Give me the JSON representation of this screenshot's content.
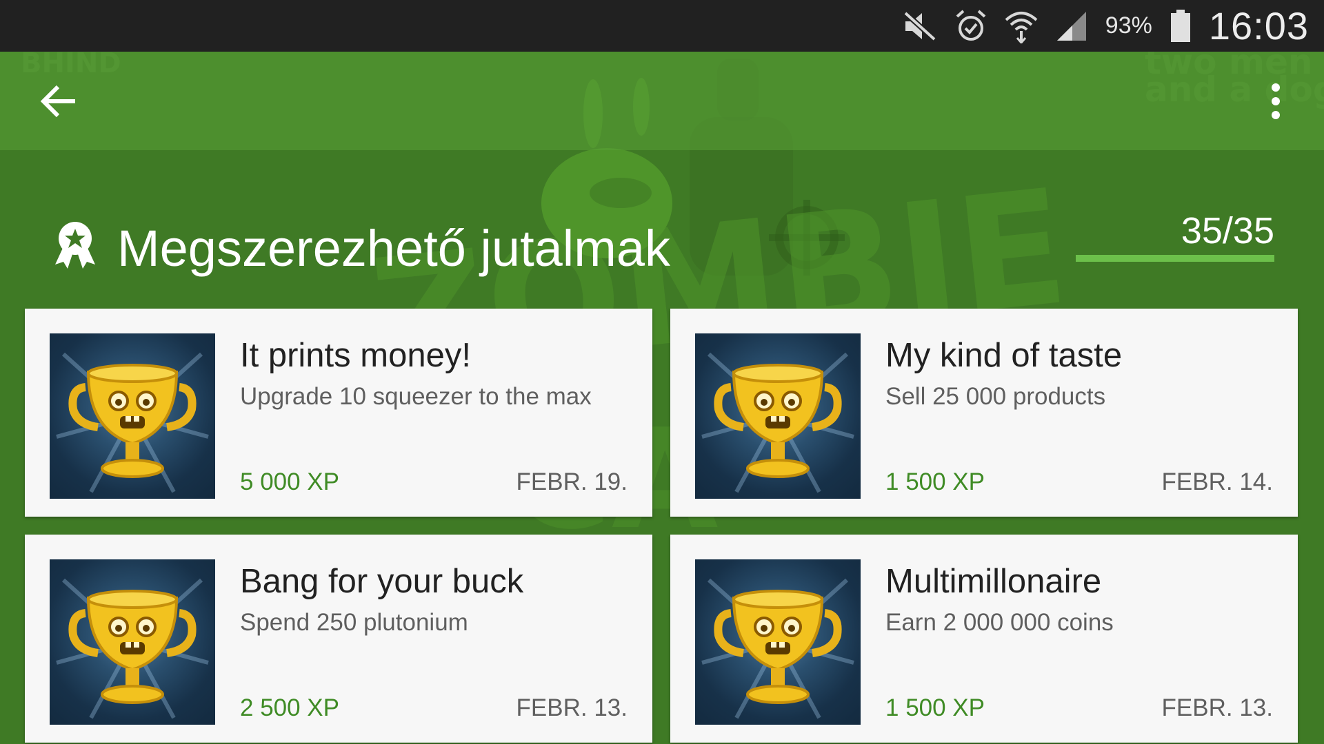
{
  "status_bar": {
    "battery_percent": "93%",
    "time": "16:03",
    "icons": [
      "mute-icon",
      "alarm-icon",
      "wifi-icon",
      "signal-icon",
      "battery-icon"
    ]
  },
  "toolbar": {
    "back_icon": "back-arrow-icon",
    "menu_icon": "more-vert-icon"
  },
  "header": {
    "icon": "award-ribbon-icon",
    "title": "Megszerezhető jutalmak",
    "progress_text": "35/35",
    "progress_fraction": 1.0
  },
  "achievements": [
    {
      "title": "It prints money!",
      "description": "Upgrade 10 squeezer to the max",
      "xp": "5 000 XP",
      "date": "FEBR. 19.",
      "icon": "trophy-icon"
    },
    {
      "title": "My kind of taste",
      "description": "Sell 25 000 products",
      "xp": "1 500 XP",
      "date": "FEBR. 14.",
      "icon": "trophy-icon"
    },
    {
      "title": "Bang for your buck",
      "description": "Spend 250 plutonium",
      "xp": "2 500 XP",
      "date": "FEBR. 13.",
      "icon": "trophy-icon"
    },
    {
      "title": "Multimillonaire",
      "description": "Earn 2 000 000 coins",
      "xp": "1 500 XP",
      "date": "FEBR. 13.",
      "icon": "trophy-icon"
    }
  ],
  "colors": {
    "background_green": "#3f7a25",
    "xp_green": "#3f8b25",
    "progress_green": "#6cc04a",
    "status_bar": "#212121",
    "card_background": "#f7f7f7"
  }
}
